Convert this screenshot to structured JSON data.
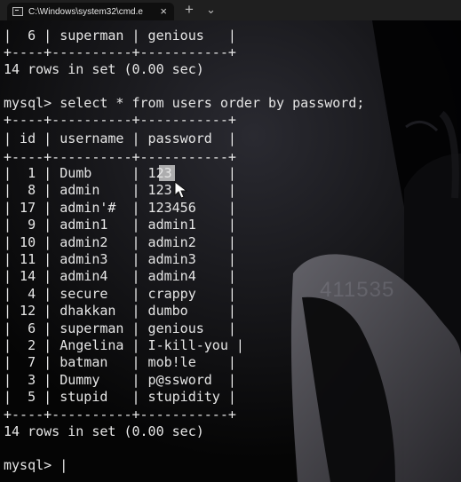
{
  "window": {
    "tab_title": "C:\\Windows\\system32\\cmd.e",
    "tab_close": "×",
    "new_tab": "+",
    "dropdown": "⌄"
  },
  "terminal": {
    "prev_row": "|  6 | superman | genious   |",
    "prev_border": "+----+----------+-----------+",
    "rows_in_set_1": "14 rows in set (0.00 sec)",
    "query": "mysql> select * from users order by password;",
    "border": "+----+----------+-----------+",
    "header": "| id | username | password  |",
    "rows": [
      {
        "id": "1",
        "username": "Dumb",
        "password": "123"
      },
      {
        "id": "8",
        "username": "admin",
        "password": "123"
      },
      {
        "id": "17",
        "username": "admin'#",
        "password": "123456"
      },
      {
        "id": "9",
        "username": "admin1",
        "password": "admin1"
      },
      {
        "id": "10",
        "username": "admin2",
        "password": "admin2"
      },
      {
        "id": "11",
        "username": "admin3",
        "password": "admin3"
      },
      {
        "id": "14",
        "username": "admin4",
        "password": "admin4"
      },
      {
        "id": "4",
        "username": "secure",
        "password": "crappy"
      },
      {
        "id": "12",
        "username": "dhakkan",
        "password": "dumbo"
      },
      {
        "id": "6",
        "username": "superman",
        "password": "genious"
      },
      {
        "id": "2",
        "username": "Angelina",
        "password": "I-kill-you"
      },
      {
        "id": "7",
        "username": "batman",
        "password": "mob!le"
      },
      {
        "id": "3",
        "username": "Dummy",
        "password": "p@ssword"
      },
      {
        "id": "5",
        "username": "stupid",
        "password": "stupidity"
      }
    ],
    "rows_in_set_2": "14 rows in set (0.00 sec)",
    "prompt": "mysql> |",
    "watermark": "411535"
  }
}
